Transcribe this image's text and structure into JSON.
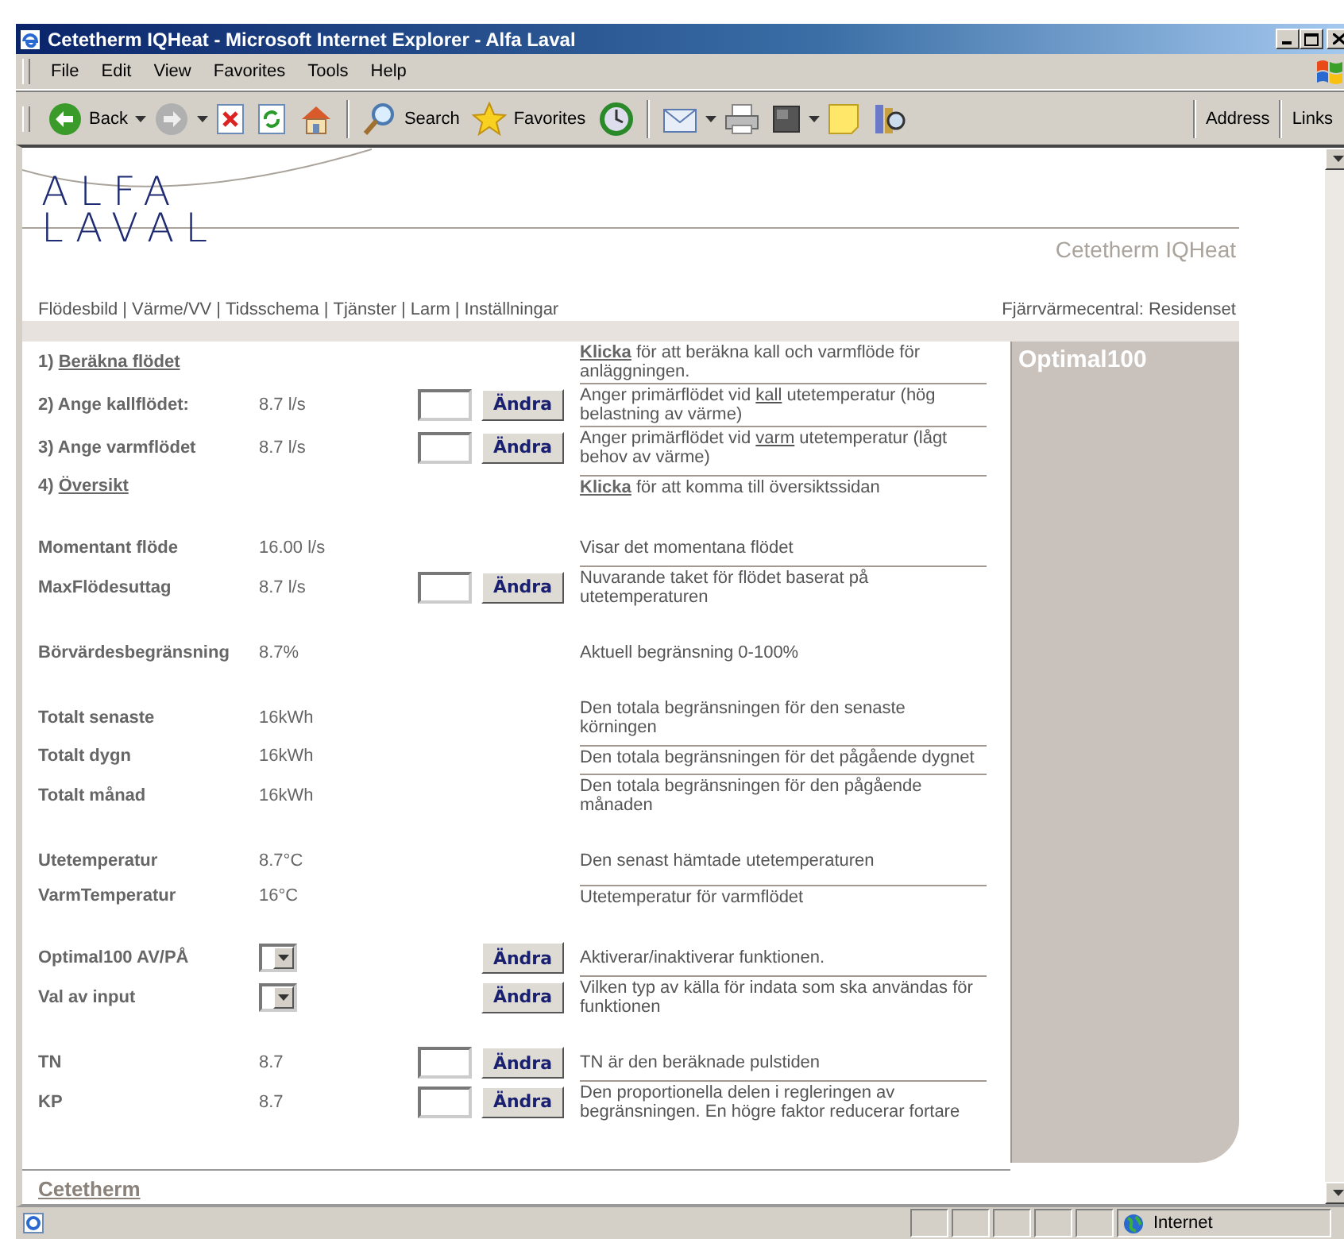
{
  "window": {
    "title": "Cetetherm IQHeat - Microsoft Internet Explorer - Alfa Laval"
  },
  "menu": [
    "File",
    "Edit",
    "View",
    "Favorites",
    "Tools",
    "Help"
  ],
  "toolbar": {
    "back": "Back",
    "search": "Search",
    "favorites": "Favorites",
    "address": "Address",
    "links": "Links"
  },
  "page": {
    "logo": [
      "ALFA",
      "LAVAL"
    ],
    "brand": "Cetetherm IQHeat",
    "nav_separator": "|",
    "nav": [
      "Flödesbild",
      "Värme/VV",
      "Tidsschema",
      "Tjänster",
      "Larm",
      "Inställningar"
    ],
    "site": "Fjärrvärmecentral: Residenset",
    "panel_title": "Optimal100",
    "groups": [
      {
        "rows": [
          {
            "kind": "link",
            "number": "1)",
            "label": "Beräkna flödet",
            "description": [
              {
                "text": "Klicka",
                "link": true
              },
              {
                "text": " för att beräkna kall och varmflöde för anläggningen.",
                "link": false
              }
            ]
          },
          {
            "kind": "input",
            "label": "2) Ange kallflödet:",
            "value": "8.7 l/s",
            "button": "Ändra",
            "description": [
              {
                "text": "Anger primärflödet vid ",
                "link": false
              },
              {
                "text": "kall",
                "link": true
              },
              {
                "text": " utetemperatur (hög belastning av värme)",
                "link": false
              }
            ]
          },
          {
            "kind": "input",
            "label": "3) Ange varmflödet",
            "value": "8.7 l/s",
            "button": "Ändra",
            "description": [
              {
                "text": "Anger primärflödet vid ",
                "link": false
              },
              {
                "text": "varm",
                "link": true
              },
              {
                "text": " utetemperatur (lågt behov av värme)",
                "link": false
              }
            ]
          },
          {
            "kind": "link",
            "number": "4)",
            "label": "Översikt",
            "description": [
              {
                "text": "Klicka",
                "link": true
              },
              {
                "text": " för att komma till översiktssidan",
                "link": false
              }
            ]
          }
        ]
      },
      {
        "rows": [
          {
            "kind": "readout",
            "label": "Momentant flöde",
            "value": "16.00 l/s",
            "description": [
              {
                "text": "Visar det momentana flödet",
                "link": false
              }
            ]
          },
          {
            "kind": "input",
            "label": "MaxFlödesuttag",
            "value": "8.7 l/s",
            "button": "Ändra",
            "description": [
              {
                "text": "Nuvarande taket för flödet baserat på utetemperaturen",
                "link": false
              }
            ]
          }
        ]
      },
      {
        "rows": [
          {
            "kind": "readout",
            "label": "Börvärdesbegränsning",
            "value": "8.7%",
            "description": [
              {
                "text": "Aktuell begränsning 0-100%",
                "link": false
              }
            ]
          }
        ]
      },
      {
        "rows": [
          {
            "kind": "readout",
            "label": "Totalt senaste",
            "value": "16kWh",
            "description": [
              {
                "text": "Den totala begränsningen för den senaste körningen",
                "link": false
              }
            ]
          },
          {
            "kind": "readout",
            "label": "Totalt dygn",
            "value": "16kWh",
            "description": [
              {
                "text": "Den totala begränsningen för det pågående dygnet",
                "link": false
              }
            ]
          },
          {
            "kind": "readout",
            "label": "Totalt månad",
            "value": "16kWh",
            "description": [
              {
                "text": "Den totala begränsningen för den pågående månaden",
                "link": false
              }
            ]
          }
        ]
      },
      {
        "rows": [
          {
            "kind": "readout",
            "label": "Utetemperatur",
            "value": "8.7°C",
            "description": [
              {
                "text": "Den senast hämtade utetemperaturen",
                "link": false
              }
            ]
          },
          {
            "kind": "readout",
            "label": "VarmTemperatur",
            "value": "16°C",
            "description": [
              {
                "text": "Utetemperatur för varmflödet",
                "link": false
              }
            ]
          }
        ]
      },
      {
        "rows": [
          {
            "kind": "dropdown",
            "label": "Optimal100 AV/PÅ",
            "button": "Ändra",
            "description": [
              {
                "text": "Aktiverar/inaktiverar funktionen.",
                "link": false
              }
            ]
          },
          {
            "kind": "dropdown",
            "label": "Val av input",
            "button": "Ändra",
            "description": [
              {
                "text": "Vilken typ av källa för indata som ska användas för funktionen",
                "link": false
              }
            ]
          }
        ]
      },
      {
        "rows": [
          {
            "kind": "input",
            "label": "TN",
            "value": "8.7",
            "button": "Ändra",
            "description": [
              {
                "text": "TN är den beräknade pulstiden",
                "link": false
              }
            ]
          },
          {
            "kind": "input",
            "label": "KP",
            "value": "8.7",
            "button": "Ändra",
            "description": [
              {
                "text": "Den proportionella delen i regleringen av begränsningen. En högre faktor reducerar fortare",
                "link": false
              }
            ]
          }
        ]
      }
    ],
    "footer_brand": "Cetetherm"
  },
  "status_bar": {
    "zone": "Internet"
  }
}
